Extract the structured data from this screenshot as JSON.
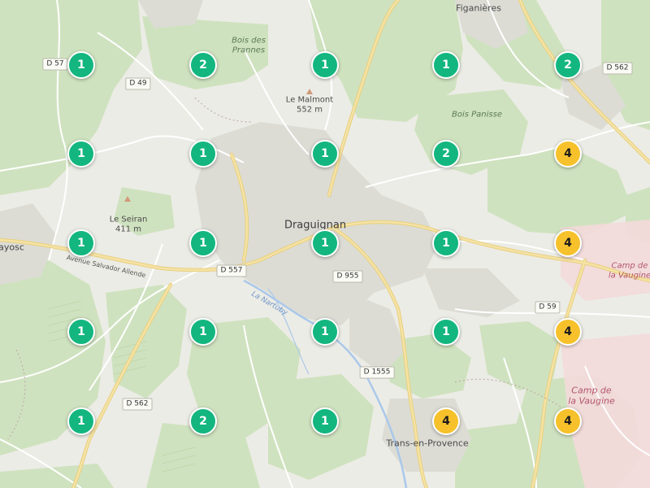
{
  "map": {
    "colors": {
      "cluster_green": "#13b67f",
      "cluster_yellow": "#f6c12b",
      "forest": "#cfe2bf",
      "urban": "#dcdcd5",
      "major_road": "#f4e3a5",
      "river": "#aac8ea",
      "military": "#f3dada"
    },
    "places": {
      "draguignan": "Draguignan",
      "figanieres": "Figanières",
      "trans_en_provence": "Trans-en-Provence",
      "flayosc": "ayosc",
      "le_malmont": "Le Malmont",
      "le_malmont_elev": "552 m",
      "le_seiran": "Le Seiran",
      "le_seiran_elev": "411 m",
      "bois_des_prannes_1": "Bois des",
      "bois_des_prannes_2": "Prannes",
      "bois_panisse": "Bois Panisse",
      "camp_vaugine_a_1": "Camp de",
      "camp_vaugine_a_2": "la Vaugine",
      "camp_vaugine_b_1": "Camp de",
      "camp_vaugine_b_2": "la Vaugine"
    },
    "roads": {
      "d57": "D 57",
      "d49": "D 49",
      "d562_ne": "D 562",
      "d557": "D 557",
      "d955": "D 955",
      "d59": "D 59",
      "d1555": "D 1555",
      "d562_sw": "D 562",
      "avenue": "Avenue Salvador Allende",
      "river": "La Nartuby"
    },
    "clusters": [
      {
        "count": "1",
        "level": "green"
      },
      {
        "count": "2",
        "level": "green"
      },
      {
        "count": "1",
        "level": "green"
      },
      {
        "count": "1",
        "level": "green"
      },
      {
        "count": "2",
        "level": "green"
      },
      {
        "count": "1",
        "level": "green"
      },
      {
        "count": "1",
        "level": "green"
      },
      {
        "count": "1",
        "level": "green"
      },
      {
        "count": "2",
        "level": "green"
      },
      {
        "count": "4",
        "level": "yellow"
      },
      {
        "count": "1",
        "level": "green"
      },
      {
        "count": "1",
        "level": "green"
      },
      {
        "count": "1",
        "level": "green"
      },
      {
        "count": "1",
        "level": "green"
      },
      {
        "count": "4",
        "level": "yellow"
      },
      {
        "count": "1",
        "level": "green"
      },
      {
        "count": "1",
        "level": "green"
      },
      {
        "count": "1",
        "level": "green"
      },
      {
        "count": "1",
        "level": "green"
      },
      {
        "count": "4",
        "level": "yellow"
      },
      {
        "count": "1",
        "level": "green"
      },
      {
        "count": "2",
        "level": "green"
      },
      {
        "count": "1",
        "level": "green"
      },
      {
        "count": "4",
        "level": "yellow"
      },
      {
        "count": "4",
        "level": "yellow"
      }
    ]
  }
}
